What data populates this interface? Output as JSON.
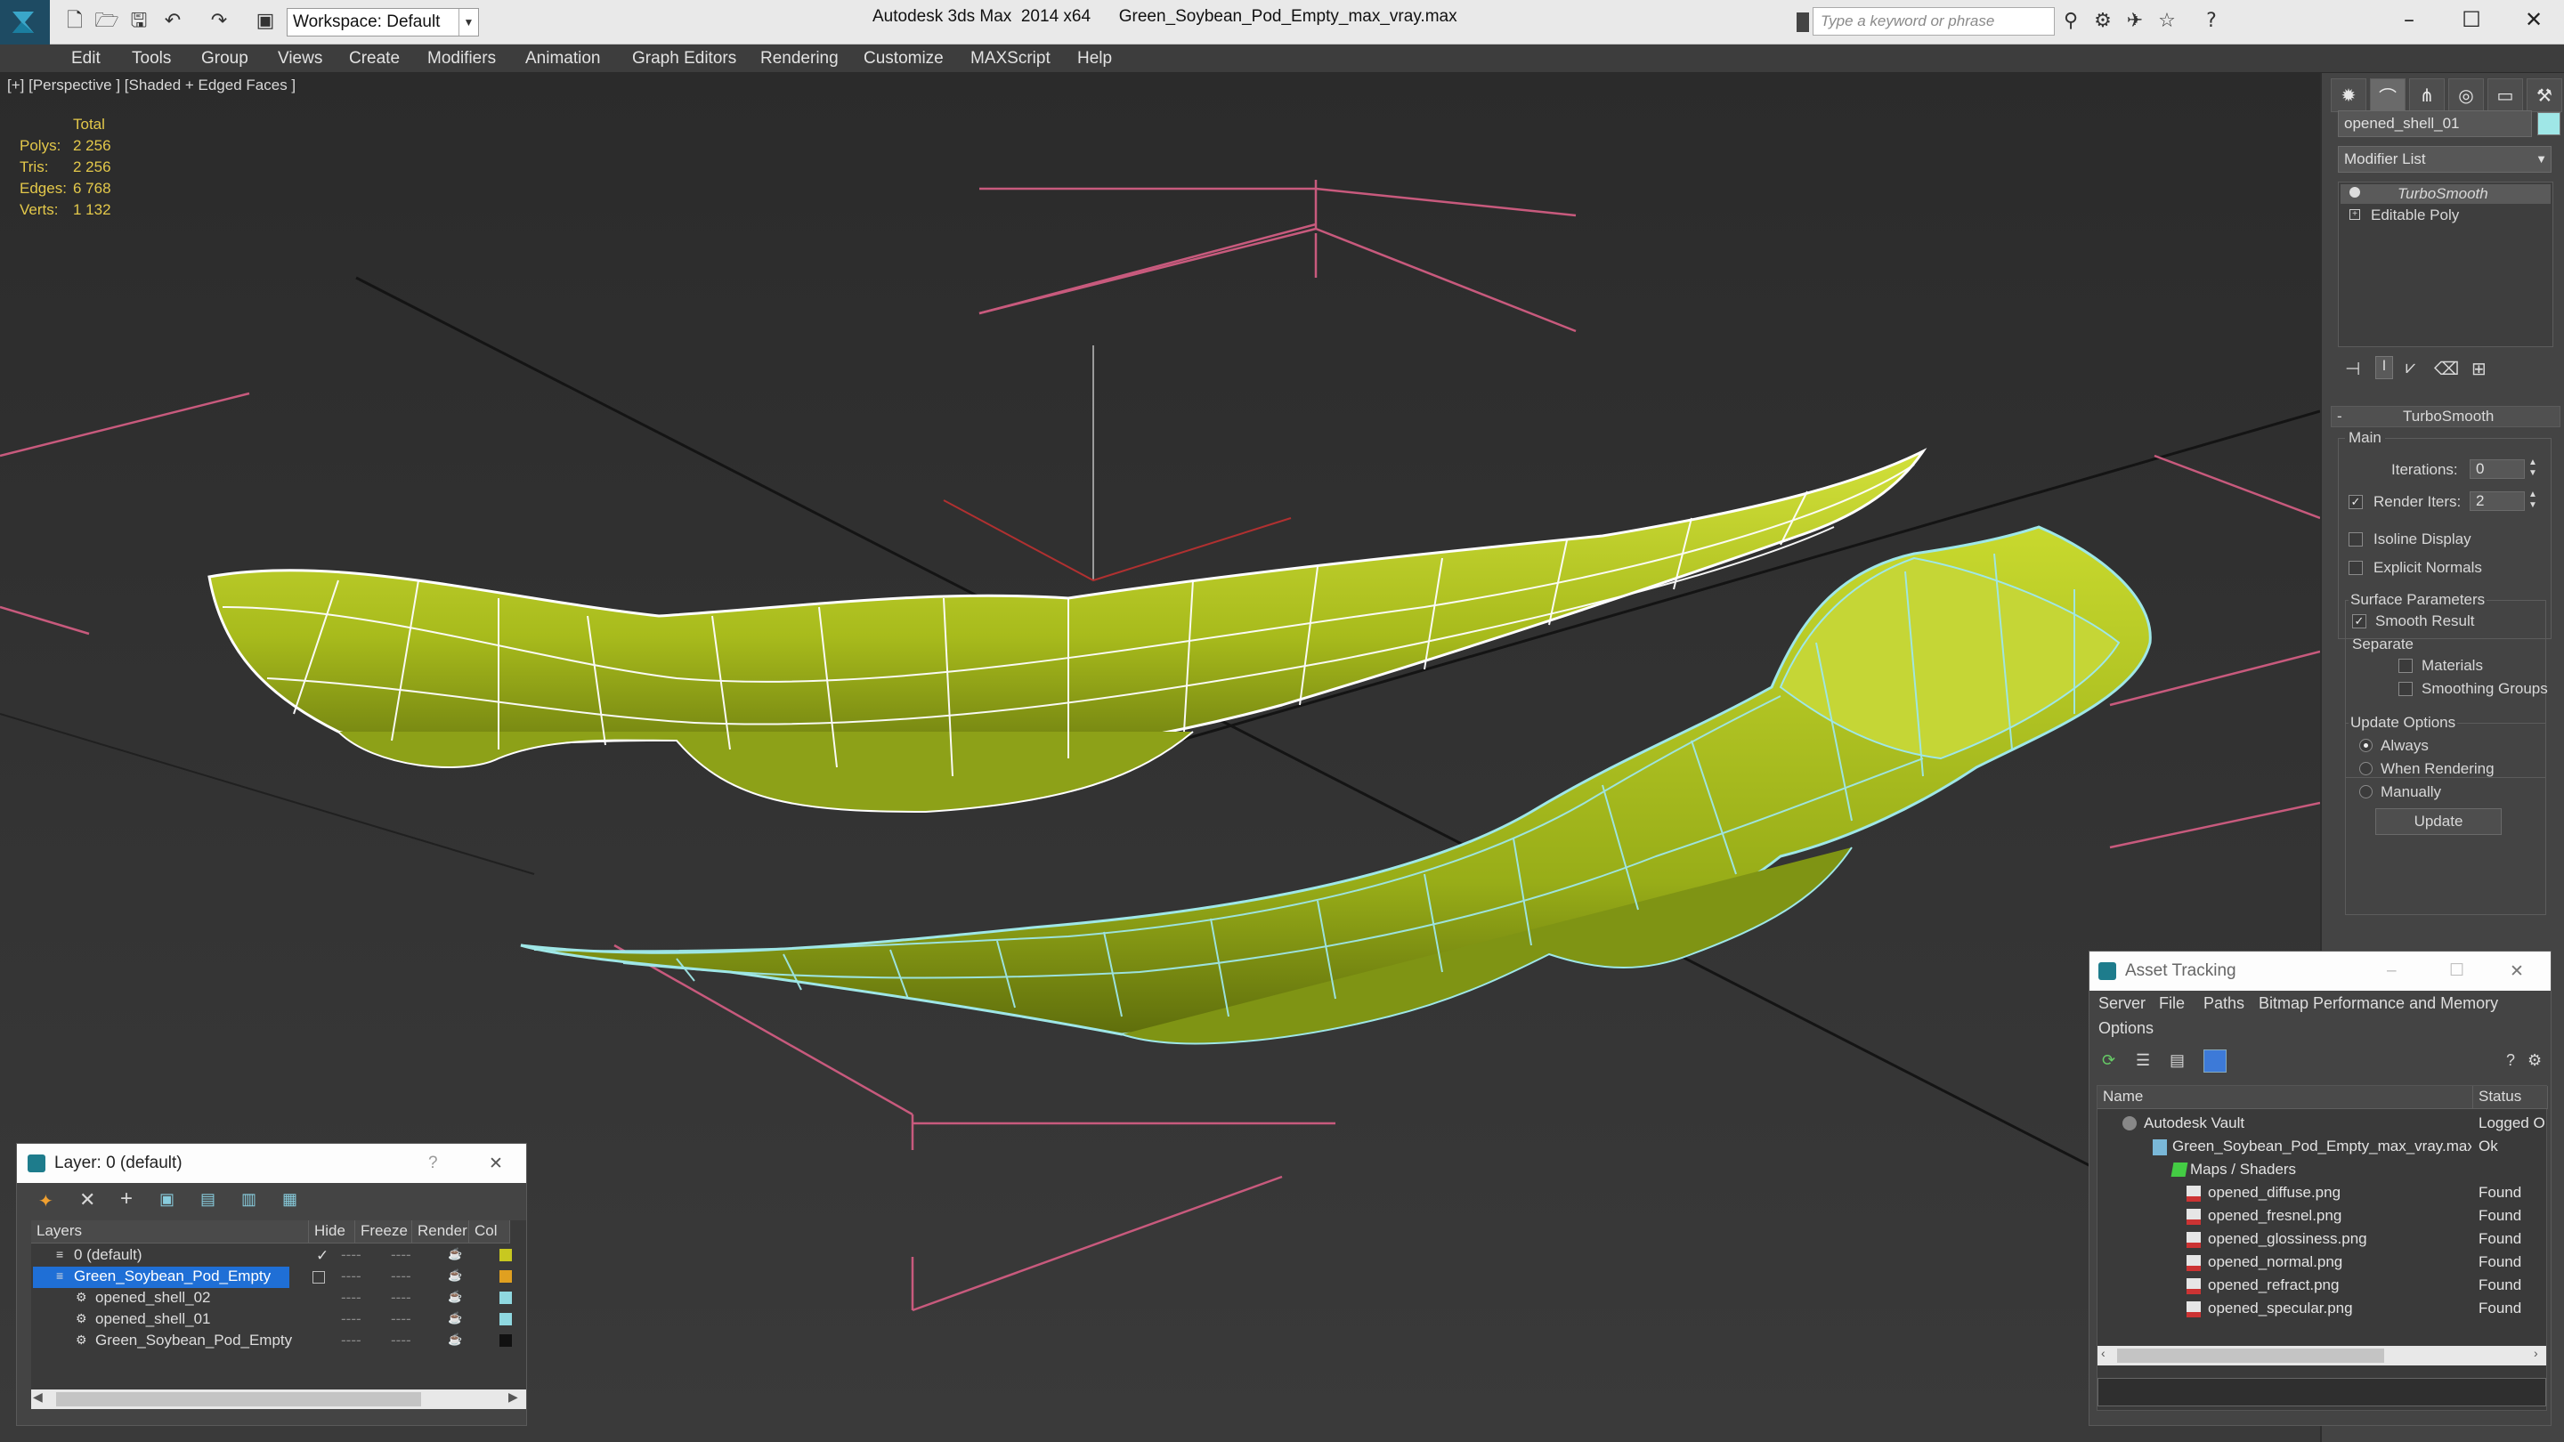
{
  "title_bar": {
    "app_title": "Autodesk 3ds Max  2014 x64",
    "file_name": "Green_Soybean_Pod_Empty_max_vray.max",
    "workspace_label": "Workspace: Default",
    "search_placeholder": "Type a keyword or phrase"
  },
  "menu": [
    "Edit",
    "Tools",
    "Group",
    "Views",
    "Create",
    "Modifiers",
    "Animation",
    "Graph Editors",
    "Rendering",
    "Customize",
    "MAXScript",
    "Help"
  ],
  "viewport": {
    "label": "[+] [Perspective ] [Shaded + Edged Faces ]",
    "stats_header": "Total",
    "stats": [
      {
        "label": "Polys:",
        "value": "2 256"
      },
      {
        "label": "Tris:",
        "value": "2 256"
      },
      {
        "label": "Edges:",
        "value": "6 768"
      },
      {
        "label": "Verts:",
        "value": "1 132"
      }
    ],
    "colors": {
      "pod": "#b4c520",
      "wire_top": "#ffffff",
      "wire_selected": "#9fe7e7",
      "grid_pink": "#c85a7d"
    }
  },
  "command_panel": {
    "object_name": "opened_shell_01",
    "modifier_list": "Modifier List",
    "stack": [
      "TurboSmooth",
      "Editable Poly"
    ],
    "rollout_title": "TurboSmooth",
    "main_group": "Main",
    "iterations_label": "Iterations:",
    "iterations_value": "0",
    "render_iters_label": "Render Iters:",
    "render_iters_value": "2",
    "isoline_display": "Isoline Display",
    "explicit_normals": "Explicit Normals",
    "surface_params": "Surface Parameters",
    "smooth_result": "Smooth Result",
    "separate": "Separate",
    "materials": "Materials",
    "smoothing_groups": "Smoothing Groups",
    "update_options": "Update Options",
    "always": "Always",
    "when_rendering": "When Rendering",
    "manually": "Manually",
    "update_button": "Update"
  },
  "layer_dialog": {
    "title": "Layer: 0 (default)",
    "columns": [
      "Layers",
      "Hide",
      "Freeze",
      "Render",
      "Col"
    ],
    "rows": [
      {
        "name": "0 (default)",
        "color": "#c8c820"
      },
      {
        "name": "Green_Soybean_Pod_Empty",
        "color": "#e0a020"
      },
      {
        "name": "opened_shell_02",
        "color": "#8fd8e0"
      },
      {
        "name": "opened_shell_01",
        "color": "#8fd8e0"
      },
      {
        "name": "Green_Soybean_Pod_Empty",
        "color": "#111111"
      }
    ],
    "dash": "----"
  },
  "asset_tracking": {
    "title": "Asset Tracking",
    "menu": [
      "Server",
      "File",
      "Paths",
      "Bitmap Performance and Memory",
      "Options"
    ],
    "columns": [
      "Name",
      "Status"
    ],
    "rows": [
      {
        "name": "Autodesk Vault",
        "status": "Logged O"
      },
      {
        "name": "Green_Soybean_Pod_Empty_max_vray.max",
        "status": "Ok"
      },
      {
        "name": "Maps / Shaders",
        "status": ""
      },
      {
        "name": "opened_diffuse.png",
        "status": "Found"
      },
      {
        "name": "opened_fresnel.png",
        "status": "Found"
      },
      {
        "name": "opened_glossiness.png",
        "status": "Found"
      },
      {
        "name": "opened_normal.png",
        "status": "Found"
      },
      {
        "name": "opened_refract.png",
        "status": "Found"
      },
      {
        "name": "opened_specular.png",
        "status": "Found"
      }
    ]
  }
}
